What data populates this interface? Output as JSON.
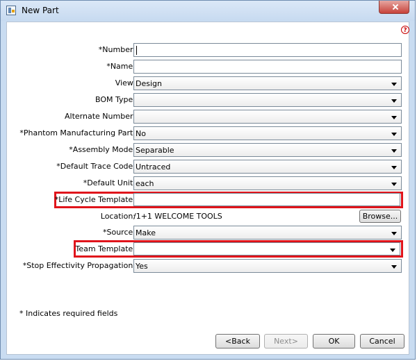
{
  "window": {
    "title": "New Part"
  },
  "help_label": "?",
  "fields": {
    "number": {
      "label": "*Number:",
      "value": ""
    },
    "name": {
      "label": "*Name:",
      "value": ""
    },
    "view": {
      "label": "View:",
      "value": "Design"
    },
    "bom_type": {
      "label": "BOM Type:",
      "value": ""
    },
    "alternate_number": {
      "label": "Alternate Number:",
      "value": ""
    },
    "phantom": {
      "label": "*Phantom Manufacturing Part:",
      "value": "No"
    },
    "assembly_mode": {
      "label": "*Assembly Mode:",
      "value": "Separable"
    },
    "trace_code": {
      "label": "*Default Trace Code:",
      "value": "Untraced"
    },
    "default_unit": {
      "label": "*Default Unit:",
      "value": "each"
    },
    "lifecycle": {
      "label": "*Life Cycle Template:",
      "value": ""
    },
    "location": {
      "label": "Location:",
      "value": "/1+1 WELCOME TOOLS",
      "browse_label": "Browse..."
    },
    "source": {
      "label": "*Source:",
      "value": "Make"
    },
    "team_template": {
      "label": "Team Template:",
      "value": ""
    },
    "stop_effectivity": {
      "label": "*Stop Effectivity Propagation:",
      "value": "Yes"
    }
  },
  "required_note": "* Indicates required fields",
  "buttons": {
    "back": "<Back",
    "next": "Next>",
    "ok": "OK",
    "cancel": "Cancel"
  },
  "colors": {
    "highlight": "#e0141b",
    "titlebar": "#c9dcf1"
  }
}
